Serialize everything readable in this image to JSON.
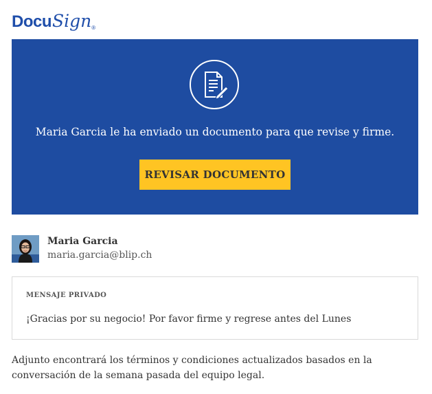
{
  "brand": {
    "logo_primary": "Docu",
    "logo_secondary": "Sign",
    "logo_mark": "®",
    "color": "#1f4eaa"
  },
  "banner": {
    "background": "#1e4ca1",
    "icon": "document-signature-icon",
    "message": "Maria Garcia le ha enviado un documento para que revise y firme.",
    "button_label": "REVISAR DOCUMENTO",
    "button_color": "#ffc423"
  },
  "sender": {
    "name": "Maria Garcia",
    "email": "maria.garcia@blip.ch",
    "avatar_icon": "avatar-photo"
  },
  "private_message": {
    "label": "MENSAJE PRIVADO",
    "text": "¡Gracias por su negocio! Por favor firme y regrese antes del Lunes"
  },
  "body": {
    "text": "Adjunto encontrará los términos y condiciones actualizados basados en la conversación de la semana pasada del equipo legal."
  }
}
